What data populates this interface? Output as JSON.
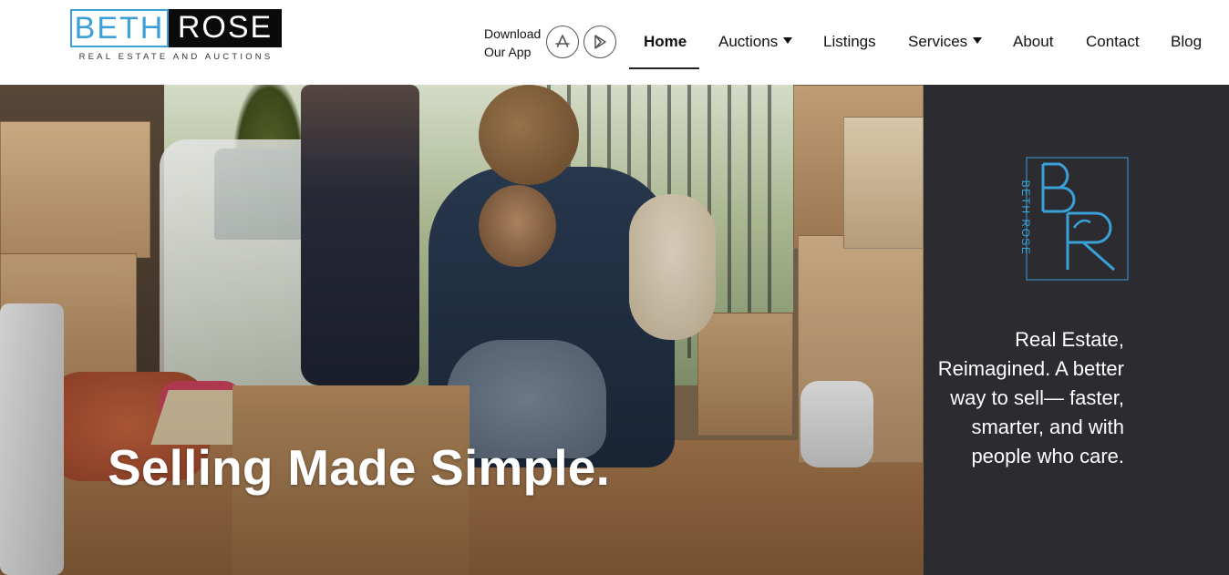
{
  "header": {
    "logo": {
      "word_left": "BETH",
      "word_right": "ROSE",
      "tagline": "REAL ESTATE AND AUCTIONS"
    },
    "app_download": {
      "label_line1": "Download",
      "label_line2": "Our App",
      "ios_icon": "app-store-icon",
      "android_icon": "google-play-icon"
    },
    "nav": [
      {
        "label": "Home",
        "active": true,
        "dropdown": false
      },
      {
        "label": "Auctions",
        "active": false,
        "dropdown": true
      },
      {
        "label": "Listings",
        "active": false,
        "dropdown": false
      },
      {
        "label": "Services",
        "active": false,
        "dropdown": true
      },
      {
        "label": "About",
        "active": false,
        "dropdown": false
      },
      {
        "label": "Contact",
        "active": false,
        "dropdown": false
      },
      {
        "label": "Blog",
        "active": false,
        "dropdown": false
      }
    ]
  },
  "hero": {
    "title": "Selling Made Simple."
  },
  "side_panel": {
    "monogram_text": "BETH ROSE",
    "tagline": "Real Estate, Reimagined. A better way to sell— faster, smarter, and with people who care."
  },
  "colors": {
    "brand_blue": "#3aa0d8",
    "brand_black": "#0a0a0a",
    "panel_dark": "#2b2b30",
    "text_dark": "#111111"
  }
}
